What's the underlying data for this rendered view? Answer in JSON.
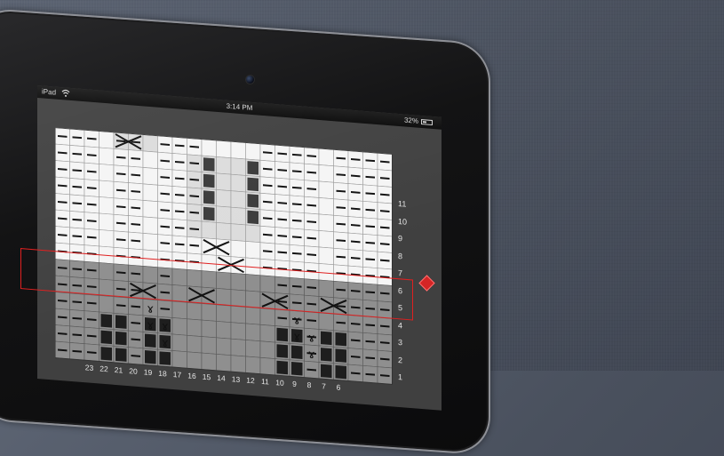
{
  "status_bar": {
    "carrier": "iPad",
    "time": "3:14 PM",
    "battery": "32%"
  },
  "chart": {
    "row_numbers": [
      "11",
      "10",
      "9",
      "8",
      "7",
      "6",
      "5",
      "4",
      "3",
      "2",
      "1"
    ],
    "col_numbers": [
      "23",
      "22",
      "21",
      "20",
      "19",
      "18",
      "17",
      "16",
      "15",
      "14",
      "13",
      "12",
      "11",
      "10",
      "9",
      "8",
      "7",
      "6"
    ],
    "current_row": "5"
  },
  "colors": {
    "highlight": "#e02020",
    "marker": "#d42525"
  }
}
